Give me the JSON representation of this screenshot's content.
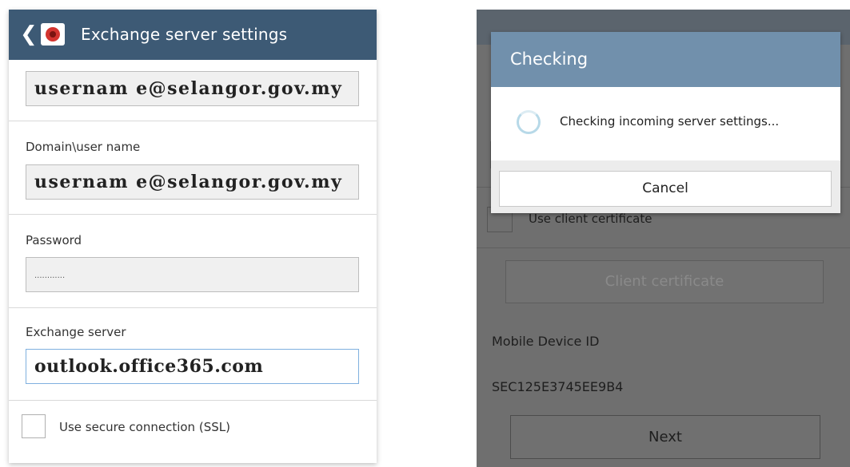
{
  "left_screen": {
    "app_bar": {
      "back_icon": "back-chevron-icon",
      "app_icon": "exchange-app-icon",
      "title": "Exchange server settings"
    },
    "email_value": "usernam e@selangor.gov.my",
    "domain_user": {
      "label": "Domain\\user name",
      "value": "usernam e@selangor.gov.my"
    },
    "password": {
      "label": "Password",
      "value": "············"
    },
    "exchange_server": {
      "label": "Exchange server",
      "value": "outlook.office365.com"
    },
    "ssl": {
      "label": "Use secure connection (SSL)",
      "checked": false
    }
  },
  "right_screen": {
    "dialog": {
      "title": "Checking",
      "message": "Checking incoming server settings...",
      "cancel_label": "Cancel"
    },
    "client_certificate_checkbox_label": "Use client certificate",
    "client_certificate_button": "Client certificate",
    "mobile_device_id_label": "Mobile Device ID",
    "mobile_device_id_value": "SEC125E3745EE9B4",
    "next_label": "Next"
  },
  "colors": {
    "app_bar": "#3d5a75",
    "dialog_header": "#7190ac",
    "dim_overlay": "#6f6f6f",
    "active_field_border": "#7fb0df"
  }
}
